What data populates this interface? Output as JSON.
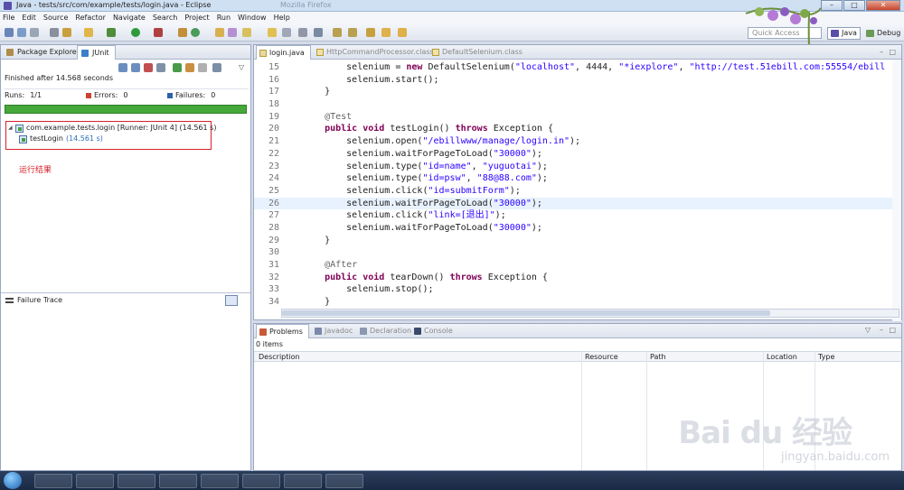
{
  "window": {
    "title": "Java - tests/src/com/example/tests/login.java - Eclipse",
    "ghost_title": "Mozilla Firefox"
  },
  "menu": [
    "File",
    "Edit",
    "Source",
    "Refactor",
    "Navigate",
    "Search",
    "Project",
    "Run",
    "Window",
    "Help"
  ],
  "toolbar": {
    "quick_access_placeholder": "Quick Access",
    "perspectives": [
      "Java",
      "Debug"
    ]
  },
  "left_panel": {
    "tabs": [
      "Package Explorer",
      "JUnit"
    ],
    "status": "Finished after 14.568 seconds",
    "runs_label": "Runs:",
    "runs_value": "1/1",
    "errors_label": "Errors:",
    "errors_value": "0",
    "failures_label": "Failures:",
    "failures_value": "0",
    "progress": 1.0,
    "tree": {
      "suite": "com.example.tests.login [Runner: JUnit 4] (14.561 s)",
      "test_name": "testLogin",
      "test_duration": "(14.561 s)"
    },
    "annotation": "运行结果",
    "failure_trace": "Failure Trace"
  },
  "editor": {
    "tabs": [
      "login.java",
      "HttpCommandProcessor.class",
      "DefaultSelenium.class"
    ],
    "lines": [
      {
        "n": "15",
        "segs": [
          [
            "",
            "        selenium = "
          ],
          [
            "kw",
            "new"
          ],
          [
            "",
            " DefaultSelenium("
          ],
          [
            "str",
            "\"localhost\""
          ],
          [
            "",
            ", 4444, "
          ],
          [
            "str",
            "\"*iexplore\""
          ],
          [
            "",
            ", "
          ],
          [
            "str",
            "\"http://test.51ebill.com:55554/ebill"
          ]
        ]
      },
      {
        "n": "16",
        "segs": [
          [
            "",
            "        selenium.start();"
          ]
        ]
      },
      {
        "n": "17",
        "segs": [
          [
            "",
            "    }"
          ]
        ]
      },
      {
        "n": "18",
        "segs": [
          [
            "",
            ""
          ]
        ]
      },
      {
        "n": "19",
        "segs": [
          [
            "ann",
            "    @Test"
          ]
        ]
      },
      {
        "n": "20",
        "segs": [
          [
            "kw",
            "    public void"
          ],
          [
            "",
            " testLogin() "
          ],
          [
            "kw",
            "throws"
          ],
          [
            "",
            " Exception {"
          ]
        ]
      },
      {
        "n": "21",
        "segs": [
          [
            "",
            "        selenium.open("
          ],
          [
            "str",
            "\"/ebillwww/manage/login.in\""
          ],
          [
            "",
            ");"
          ]
        ]
      },
      {
        "n": "22",
        "segs": [
          [
            "",
            "        selenium.waitForPageToLoad("
          ],
          [
            "str",
            "\"30000\""
          ],
          [
            "",
            ");"
          ]
        ]
      },
      {
        "n": "23",
        "segs": [
          [
            "",
            "        selenium.type("
          ],
          [
            "str",
            "\"id=name\""
          ],
          [
            "",
            ", "
          ],
          [
            "str",
            "\"yuguotai\""
          ],
          [
            "",
            ");"
          ]
        ]
      },
      {
        "n": "24",
        "segs": [
          [
            "",
            "        selenium.type("
          ],
          [
            "str",
            "\"id=psw\""
          ],
          [
            "",
            ", "
          ],
          [
            "str",
            "\"88@88.com\""
          ],
          [
            "",
            ");"
          ]
        ]
      },
      {
        "n": "25",
        "segs": [
          [
            "",
            "        selenium.click("
          ],
          [
            "str",
            "\"id=submitForm\""
          ],
          [
            "",
            ");"
          ]
        ]
      },
      {
        "n": "26",
        "segs": [
          [
            "",
            "        selenium.waitForPageToLoad("
          ],
          [
            "str",
            "\"30000\""
          ],
          [
            "",
            ");"
          ]
        ]
      },
      {
        "n": "27",
        "segs": [
          [
            "",
            "        selenium.click("
          ],
          [
            "str",
            "\"link=[退出]\""
          ],
          [
            "",
            ");"
          ]
        ]
      },
      {
        "n": "28",
        "segs": [
          [
            "",
            "        selenium.waitForPageToLoad("
          ],
          [
            "str",
            "\"30000\""
          ],
          [
            "",
            ");"
          ]
        ]
      },
      {
        "n": "29",
        "segs": [
          [
            "",
            "    }"
          ]
        ]
      },
      {
        "n": "30",
        "segs": [
          [
            "",
            ""
          ]
        ]
      },
      {
        "n": "31",
        "segs": [
          [
            "ann",
            "    @After"
          ]
        ]
      },
      {
        "n": "32",
        "segs": [
          [
            "kw",
            "    public void"
          ],
          [
            "",
            " tearDown() "
          ],
          [
            "kw",
            "throws"
          ],
          [
            "",
            " Exception {"
          ]
        ]
      },
      {
        "n": "33",
        "segs": [
          [
            "",
            "        selenium.stop();"
          ]
        ]
      },
      {
        "n": "34",
        "segs": [
          [
            "",
            "    }"
          ]
        ]
      }
    ],
    "highlighted_line": "26"
  },
  "bottom_panel": {
    "tabs": [
      "Problems",
      "Javadoc",
      "Declaration",
      "Console"
    ],
    "items": "0 items",
    "columns": [
      "Description",
      "Resource",
      "Path",
      "Location",
      "Type"
    ]
  },
  "watermark": {
    "brand": "Bai du 经验",
    "url": "jingyan.baidu.com"
  },
  "colors": {
    "progress_ok": "#45a83a",
    "annotation_red": "#d6222b",
    "keyword": "#7f0055",
    "string": "#2a00ff"
  }
}
